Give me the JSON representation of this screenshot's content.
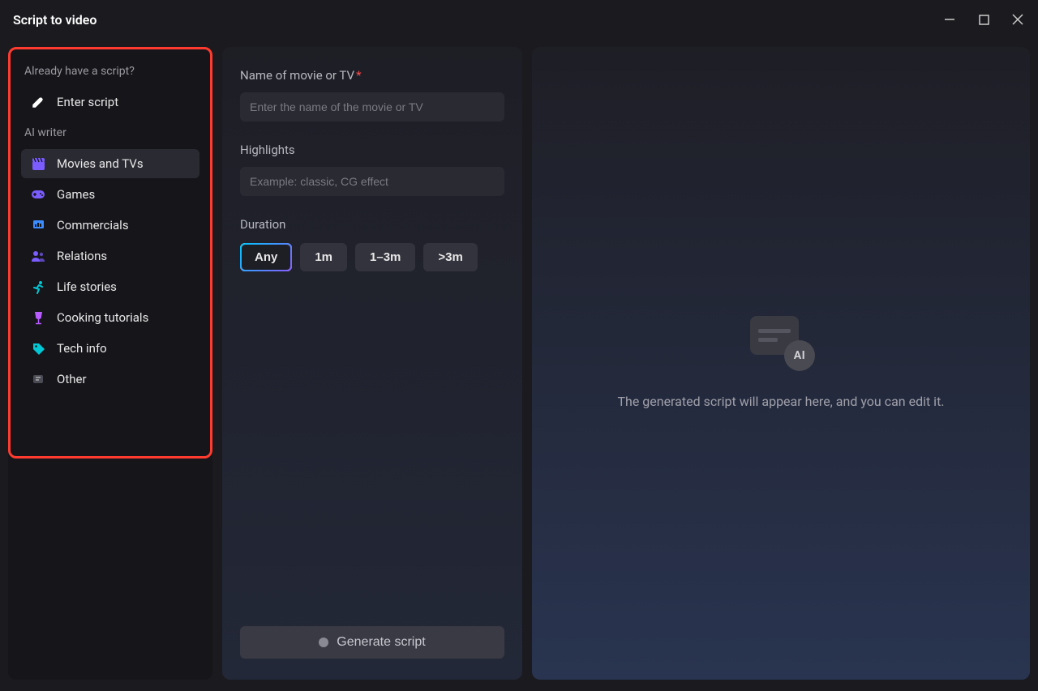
{
  "titlebar": {
    "title": "Script to video"
  },
  "sidebar": {
    "section1_label": "Already have a script?",
    "enter_script": "Enter script",
    "section2_label": "AI writer",
    "items": [
      {
        "label": "Movies and TVs",
        "active": true
      },
      {
        "label": "Games",
        "active": false
      },
      {
        "label": "Commercials",
        "active": false
      },
      {
        "label": "Relations",
        "active": false
      },
      {
        "label": "Life stories",
        "active": false
      },
      {
        "label": "Cooking tutorials",
        "active": false
      },
      {
        "label": "Tech info",
        "active": false
      },
      {
        "label": "Other",
        "active": false
      }
    ]
  },
  "form": {
    "name_label": "Name of movie or TV",
    "name_placeholder": "Enter the name of the movie or TV",
    "highlights_label": "Highlights",
    "highlights_placeholder": "Example: classic, CG effect",
    "duration_label": "Duration",
    "duration_options": [
      "Any",
      "1m",
      "1–3m",
      ">3m"
    ],
    "duration_selected": "Any",
    "generate_label": "Generate script"
  },
  "preview": {
    "ai_badge": "AI",
    "placeholder_text": "The generated script will appear here, and you can edit it."
  }
}
